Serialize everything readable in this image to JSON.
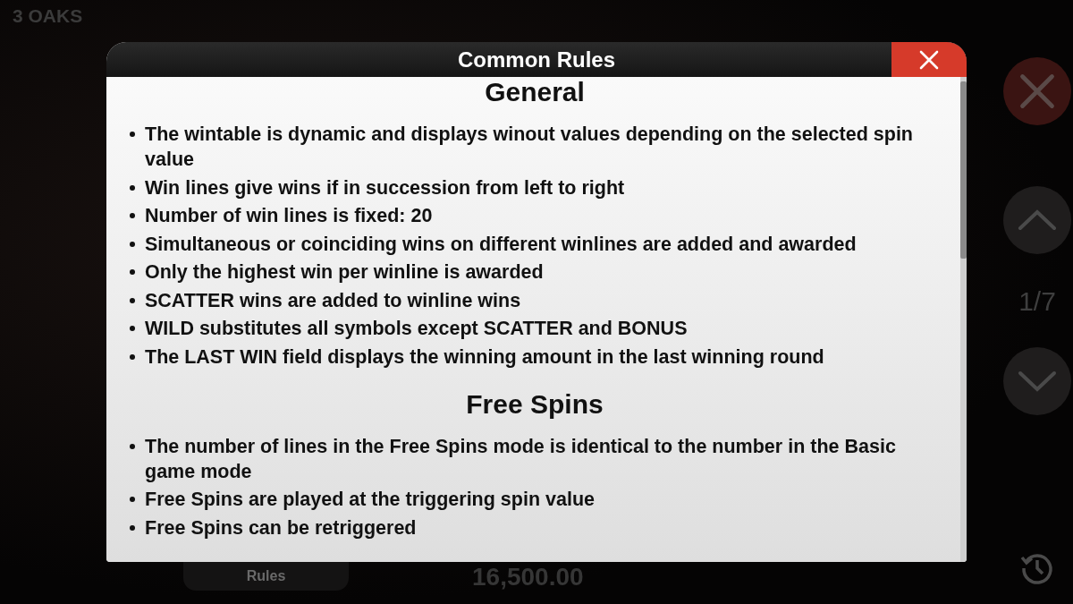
{
  "background": {
    "logo": "3 OAKS",
    "page_counter": "1/7",
    "menu_button": "Rules",
    "balance": "16,500.00"
  },
  "dialog": {
    "title": "Common Rules",
    "sections": [
      {
        "heading": "General",
        "items": [
          "The wintable is dynamic and displays winout values depending on the selected spin value",
          "Win lines give wins if in succession from left to right",
          "Number of win lines is fixed: 20",
          "Simultaneous or coinciding wins on different winlines are added and awarded",
          "Only the highest win per winline is awarded",
          "SCATTER wins are added to winline wins",
          "WILD substitutes all symbols except SCATTER and BONUS",
          "The LAST WIN field displays the winning amount in the last winning round"
        ]
      },
      {
        "heading": "Free Spins",
        "items": [
          "The number of lines in the Free Spins mode is identical to the number in the Basic game mode",
          "Free Spins are played at the triggering spin value",
          "Free Spins can be retriggered"
        ]
      }
    ]
  }
}
